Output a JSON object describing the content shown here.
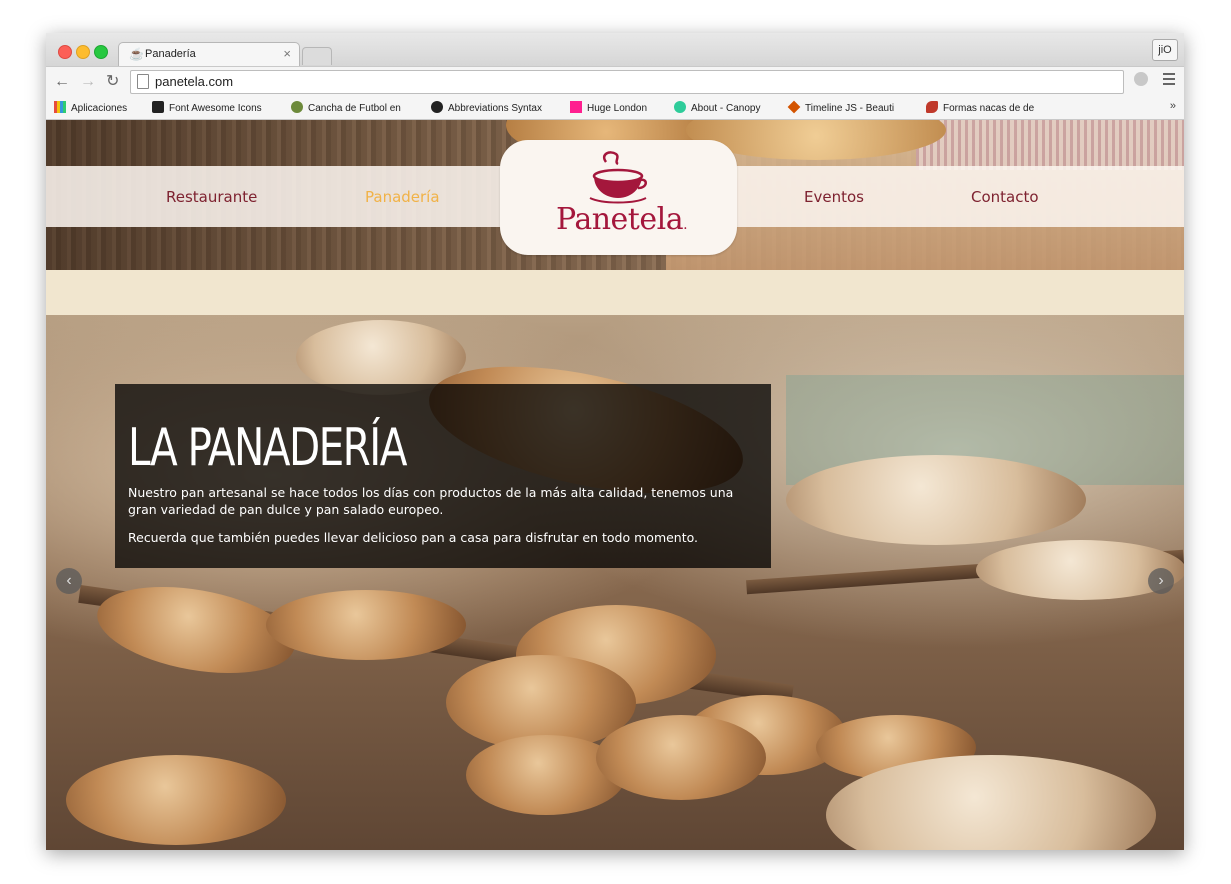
{
  "browser": {
    "tab_title": "Panadería",
    "tab_close": "×",
    "profile_label": "jiO",
    "url": "panetela.com",
    "bookmarks": [
      {
        "label": "Aplicaciones",
        "icon": "apps-grid-icon",
        "color": "#e74c3c"
      },
      {
        "label": "Font Awesome Icons",
        "icon": "flag-icon",
        "color": "#222222"
      },
      {
        "label": "Cancha de Futbol en",
        "icon": "soccer-ball-icon",
        "color": "#6d8a3b"
      },
      {
        "label": "Abbreviations Syntax",
        "icon": "globe-icon",
        "color": "#222222"
      },
      {
        "label": "Huge London",
        "icon": "huge-logo-icon",
        "color": "#ff1f8f"
      },
      {
        "label": "About - Canopy",
        "icon": "canopy-icon",
        "color": "#2ecc9a"
      },
      {
        "label": "Timeline JS - Beauti",
        "icon": "timeline-icon",
        "color": "#d35400"
      },
      {
        "label": "Formas nacas de de",
        "icon": "chili-icon",
        "color": "#c0392b"
      }
    ],
    "bookmarks_more": "»"
  },
  "site": {
    "nav": {
      "restaurante": "Restaurante",
      "panaderia": "Panadería",
      "eventos": "Eventos",
      "contacto": "Contacto"
    },
    "logo_text": "Panetela",
    "logo_dot": ".",
    "colors": {
      "brand": "#a4173c",
      "active": "#f1b247",
      "nav": "#7e2230"
    }
  },
  "slider": {
    "title": "LA PANADERÍA",
    "paragraph1": "Nuestro pan artesanal se hace todos los días con productos de la más alta calidad, tenemos una gran variedad de pan dulce y pan salado europeo.",
    "paragraph2": "Recuerda que también puedes llevar delicioso pan a casa para disfrutar en todo momento.",
    "prev_arrow": "‹",
    "next_arrow": "›"
  }
}
